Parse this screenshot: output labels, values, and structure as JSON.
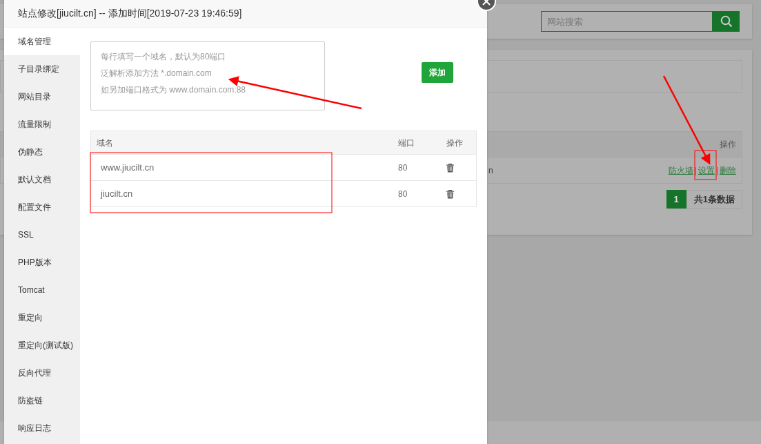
{
  "dialog": {
    "title": "站点修改[jiucilt.cn] -- 添加时间[2019-07-23 19:46:59]"
  },
  "sidebar": {
    "items": [
      {
        "label": "域名管理",
        "selected": true
      },
      {
        "label": "子目录绑定",
        "selected": false
      },
      {
        "label": "网站目录",
        "selected": false
      },
      {
        "label": "流量限制",
        "selected": false
      },
      {
        "label": "伪静态",
        "selected": false
      },
      {
        "label": "默认文档",
        "selected": false
      },
      {
        "label": "配置文件",
        "selected": false
      },
      {
        "label": "SSL",
        "selected": false
      },
      {
        "label": "PHP版本",
        "selected": false
      },
      {
        "label": "Tomcat",
        "selected": false
      },
      {
        "label": "重定向",
        "selected": false
      },
      {
        "label": "重定向(测试版)",
        "selected": false
      },
      {
        "label": "反向代理",
        "selected": false
      },
      {
        "label": "防盗链",
        "selected": false
      },
      {
        "label": "响应日志",
        "selected": false
      }
    ]
  },
  "domain_input": {
    "placeholder_lines": [
      "每行填写一个域名，默认为80端口",
      "泛解析添加方法 *.domain.com",
      "如另加端口格式为 www.domain.com:88"
    ]
  },
  "add_button": "添加",
  "domain_table": {
    "columns": [
      "域名",
      "端口",
      "操作"
    ],
    "rows": [
      {
        "domain": "www.jiucilt.cn",
        "port": "80"
      },
      {
        "domain": "jiucilt.cn",
        "port": "80"
      }
    ]
  },
  "background": {
    "search": {
      "placeholder": "网站搜索"
    },
    "site_table": {
      "columns": [
        "操作"
      ],
      "rows": [
        {
          "column_1": "n",
          "actions": [
            "防火墙",
            "设置",
            "删除"
          ],
          "separator": "|"
        }
      ]
    },
    "pagination": {
      "pages": [
        {
          "label": "1",
          "selected": true
        }
      ],
      "total": "共1条数据"
    }
  }
}
